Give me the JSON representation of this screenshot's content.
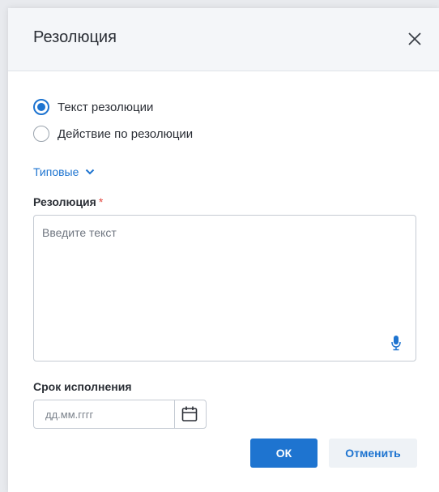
{
  "dialog": {
    "title": "Резолюция",
    "close_icon": "close-icon"
  },
  "resolution_type": {
    "options": [
      {
        "label": "Текст резолюции",
        "checked": true
      },
      {
        "label": "Действие по резолюции",
        "checked": false
      }
    ]
  },
  "typical": {
    "label": "Типовые",
    "icon": "chevron-down-icon"
  },
  "resolution_field": {
    "label": "Резолюция",
    "required_mark": "*",
    "placeholder": "Введите текст",
    "mic_icon": "microphone-icon"
  },
  "deadline_field": {
    "label": "Срок исполнения",
    "placeholder": "дд.мм.гггг",
    "calendar_icon": "calendar-icon"
  },
  "buttons": {
    "ok_label": "ОК",
    "cancel_label": "Отменить"
  },
  "colors": {
    "accent": "#1e74d0",
    "required": "#e2473f",
    "header_bg": "#f4f6f9"
  }
}
